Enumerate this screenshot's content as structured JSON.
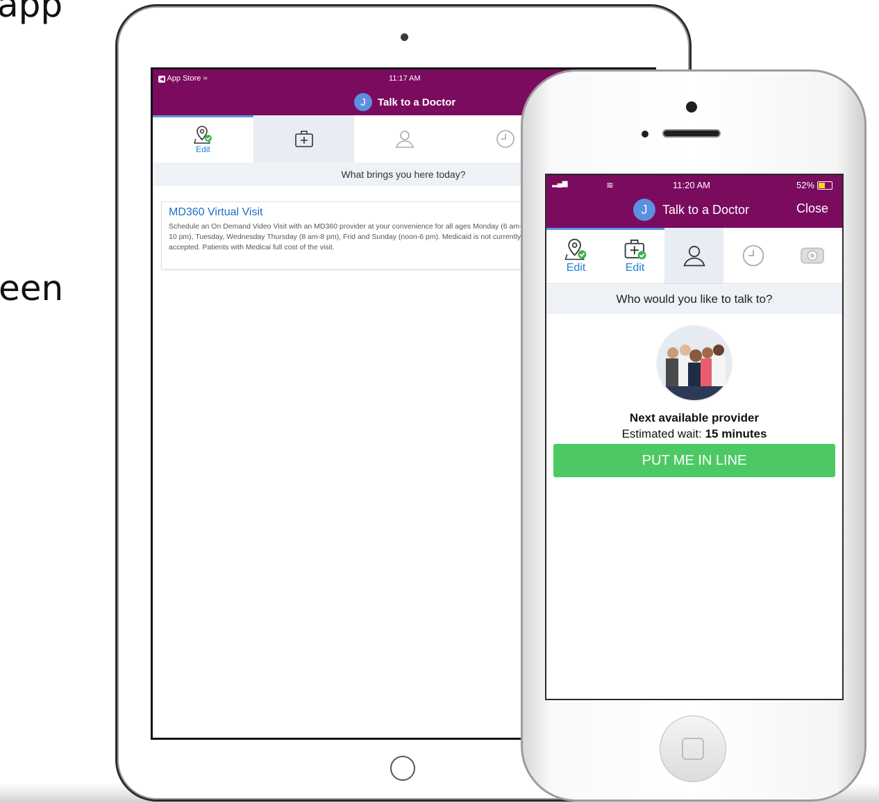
{
  "background_text": {
    "line1": "app",
    "line2": "een"
  },
  "ipad": {
    "status": {
      "back_app": "App Store",
      "time": "11:17 AM"
    },
    "header": {
      "avatar_letter": "J",
      "title": "Talk to a Doctor"
    },
    "tabs": [
      {
        "icon": "location-pin-icon",
        "label": "Edit",
        "completed": true
      },
      {
        "icon": "medical-kit-icon",
        "label": "",
        "selected": true
      },
      {
        "icon": "person-icon",
        "label": ""
      },
      {
        "icon": "clock-icon",
        "label": ""
      }
    ],
    "question": "What brings you here today?",
    "service": {
      "title": "MD360 Virtual Visit",
      "description": "Schedule an On Demand Video Visit with an MD360 provider at your convenience for all ages Monday (6 am-10 pm), Tuesday, Wednesday Thursday (8 am-8 pm), Frid and Sunday (noon-6 pm). Medicaid is not currently accepted. Patients with Medicai full cost of the visit."
    }
  },
  "iphone": {
    "status": {
      "time": "11:20 AM",
      "battery": "52%"
    },
    "header": {
      "avatar_letter": "J",
      "title": "Talk to a Doctor",
      "close": "Close"
    },
    "tabs": [
      {
        "icon": "location-pin-icon",
        "label": "Edit",
        "completed": true
      },
      {
        "icon": "medical-kit-icon",
        "label": "Edit",
        "completed": true
      },
      {
        "icon": "person-icon",
        "label": "",
        "selected": true
      },
      {
        "icon": "clock-icon",
        "label": ""
      },
      {
        "icon": "video-camera-icon",
        "label": ""
      }
    ],
    "question": "Who would you like to talk to?",
    "provider": {
      "name": "Next available provider",
      "wait_prefix": "Estimated wait: ",
      "wait_value": "15 minutes"
    },
    "cta": "PUT ME IN LINE"
  },
  "colors": {
    "header": "#7a0b5e",
    "accent": "#1d7fd6",
    "cta": "#4cc964",
    "check": "#3bb54a"
  }
}
